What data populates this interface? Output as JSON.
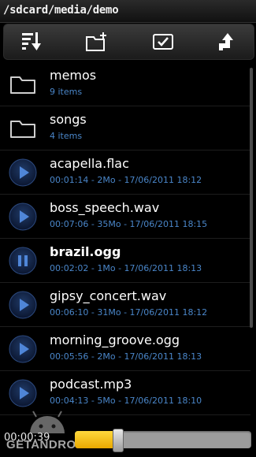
{
  "path": "/sdcard/media/demo",
  "toolbar": {
    "buttons": [
      {
        "name": "sort-icon"
      },
      {
        "name": "new-folder-icon"
      },
      {
        "name": "select-icon"
      },
      {
        "name": "up-directory-icon"
      }
    ]
  },
  "items": [
    {
      "type": "folder",
      "name": "memos",
      "meta": "9 items"
    },
    {
      "type": "folder",
      "name": "songs",
      "meta": "4 items"
    },
    {
      "type": "audio",
      "state": "play",
      "name": "acapella.flac",
      "meta": "00:01:14 - 2Mo - 17/06/2011 18:12"
    },
    {
      "type": "audio",
      "state": "play",
      "name": "boss_speech.wav",
      "meta": "00:07:06 - 35Mo - 17/06/2011 18:15"
    },
    {
      "type": "audio",
      "state": "pause",
      "name": "brazil.ogg",
      "meta": "00:02:02 - 1Mo - 17/06/2011 18:13"
    },
    {
      "type": "audio",
      "state": "play",
      "name": "gipsy_concert.wav",
      "meta": "00:06:10 - 31Mo - 17/06/2011 18:12"
    },
    {
      "type": "audio",
      "state": "play",
      "name": "morning_groove.ogg",
      "meta": "00:05:56 - 2Mo - 17/06/2011 18:13"
    },
    {
      "type": "audio",
      "state": "play",
      "name": "podcast.mp3",
      "meta": "00:04:13 - 5Mo - 17/06/2011 18:10"
    }
  ],
  "player": {
    "elapsed": "00:00:39",
    "progress": 0.24
  },
  "watermark": "GETANDROID",
  "colors": {
    "meta_text": "#4a86c9",
    "progress_fill": "#f5c518",
    "play_button": "#2e5c9e"
  }
}
